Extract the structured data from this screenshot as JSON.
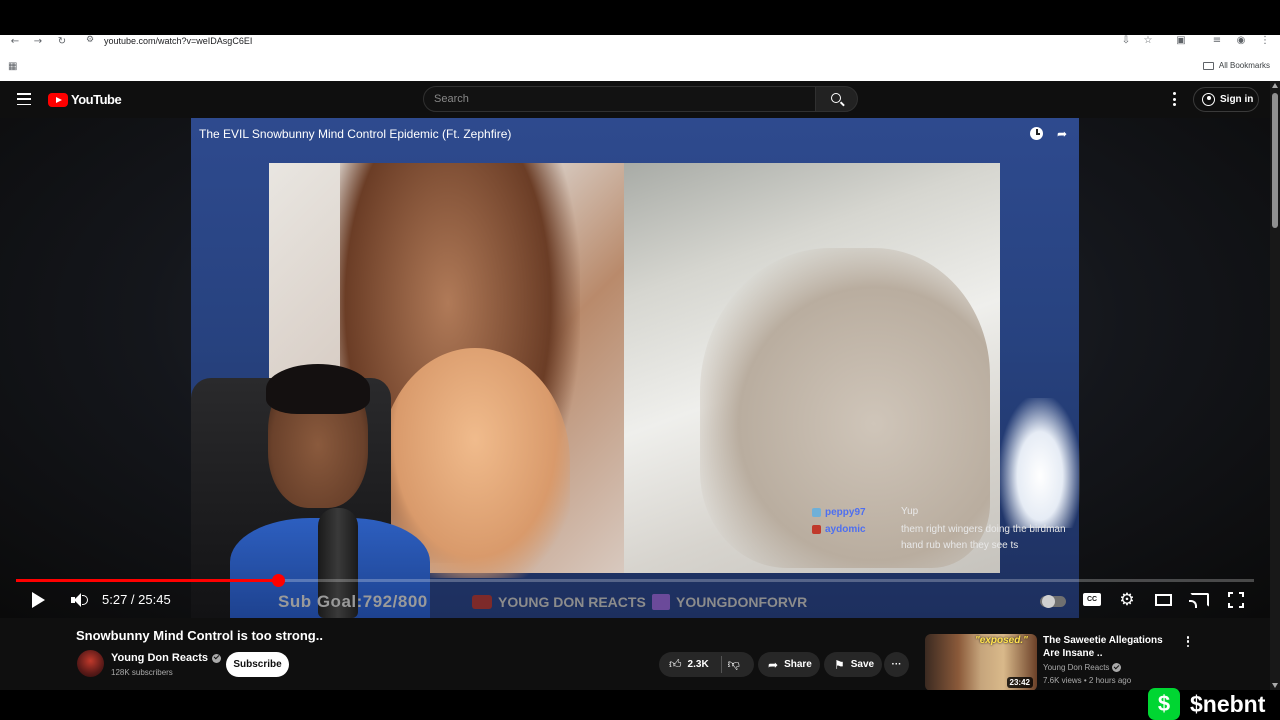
{
  "browser": {
    "url": "youtube.com/watch?v=weIDAsgC6EI",
    "bookmarks_label": "All Bookmarks"
  },
  "header": {
    "logo_text": "YouTube",
    "search_placeholder": "Search",
    "signin_label": "Sign in"
  },
  "player": {
    "overlay_title": "The EVIL Snowbunny Mind Control Epidemic (Ft. Zephfire)",
    "current_time": "5:27",
    "duration": "25:45",
    "time_display": "5:27 / 25:45",
    "progress_fraction": 0.212,
    "cc_label": "CC"
  },
  "stream_overlay": {
    "chat": [
      {
        "user": "peppy97",
        "color": "#4e6ff0",
        "message": "Yup"
      },
      {
        "user": "aydomic",
        "color": "#4e6ff0",
        "message": "them right wingers doing the birdman hand rub when they see ts"
      }
    ],
    "sub_goal": "Sub Goal:792/800",
    "youtube_handle": "YOUNG DON REACTS",
    "twitch_handle": "YOUNGDONFORVR"
  },
  "video": {
    "title": "Snowbunny Mind Control is too strong..",
    "channel_name": "Young Don Reacts",
    "subscribers": "128K subscribers",
    "subscribe_label": "Subscribe",
    "likes": "2.3K",
    "share_label": "Share",
    "save_label": "Save"
  },
  "recommended": {
    "thumb_text": "\"exposed.\"",
    "duration": "23:42",
    "title": "The Saweetie Allegations Are Insane ..",
    "channel": "Young Don Reacts",
    "meta": "7.6K views • 2 hours ago"
  },
  "watermark": {
    "cashtag": "$nebnt",
    "logo_glyph": "$"
  },
  "colors": {
    "accent": "#ff0000",
    "background": "#0f0f0f",
    "cash_green": "#00d632"
  }
}
